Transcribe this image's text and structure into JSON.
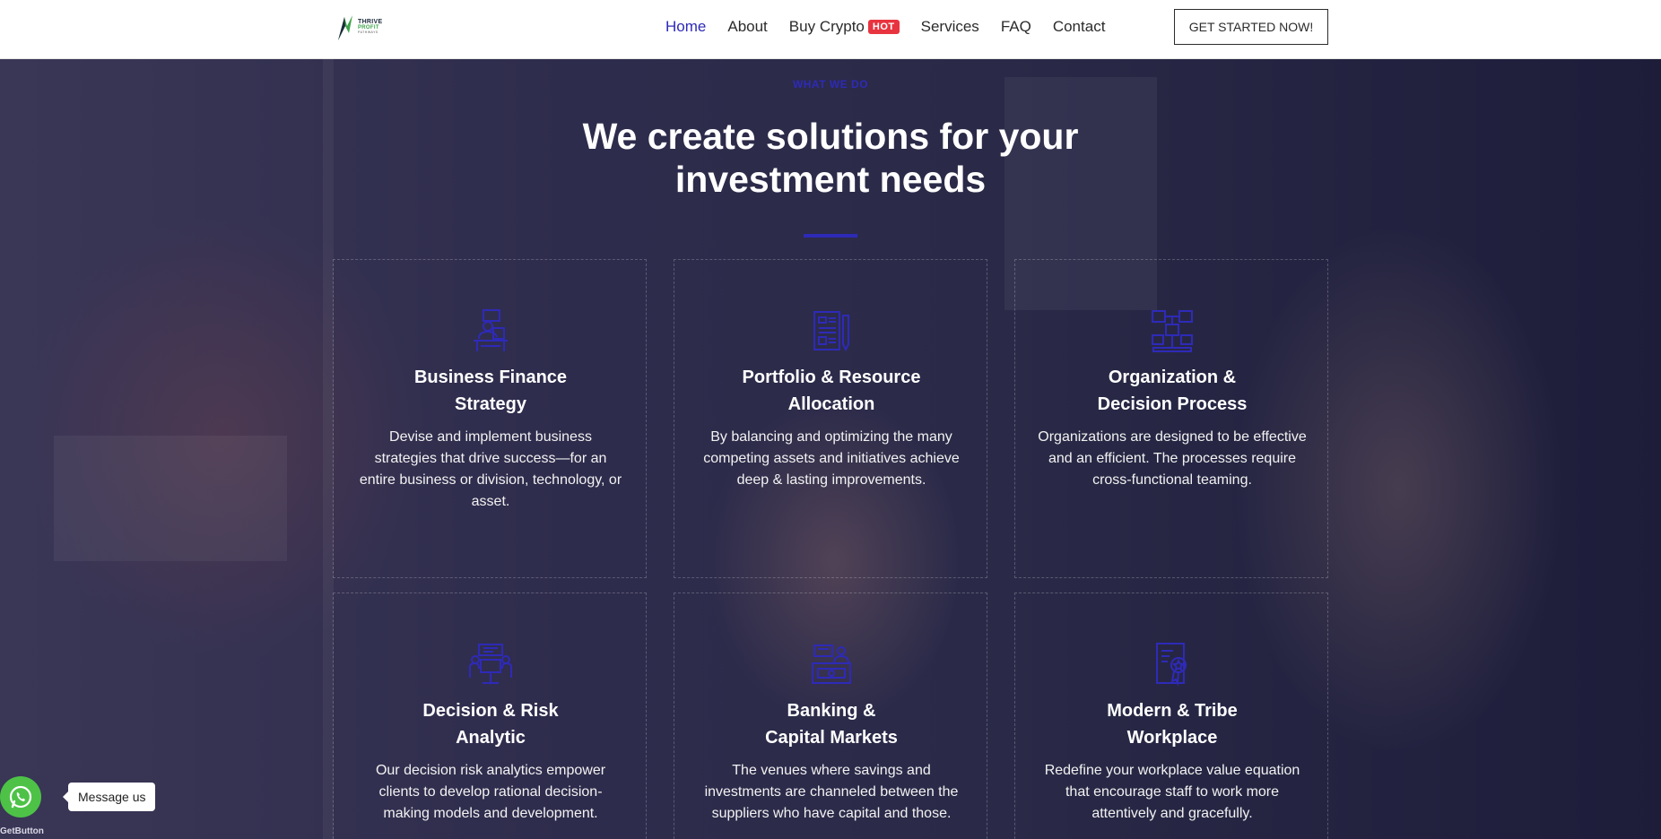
{
  "header": {
    "logo": {
      "line1": "THRIVE",
      "line2": "PROFIT",
      "line3": "PATHWAYS"
    },
    "nav": [
      {
        "label": "Home",
        "active": true
      },
      {
        "label": "About",
        "active": false
      },
      {
        "label": "Buy Crypto",
        "badge": "HOT",
        "active": false
      },
      {
        "label": "Services",
        "active": false
      },
      {
        "label": "FAQ",
        "active": false
      },
      {
        "label": "Contact",
        "active": false
      }
    ],
    "cta_label": "GET STARTED NOW!"
  },
  "section": {
    "eyebrow": "WHAT WE DO",
    "title_line1": "We create solutions for your",
    "title_line2": "investment needs"
  },
  "cards": [
    {
      "icon": "desk-worker-icon",
      "title_line1": "Business Finance",
      "title_line2": "Strategy",
      "desc_lines": [
        "Devise and implement business",
        "strategies that drive success—for an",
        "entire business or division, technology, or",
        "asset."
      ]
    },
    {
      "icon": "documents-icon",
      "title_line1": "Portfolio & Resource",
      "title_line2": "Allocation",
      "desc_lines": [
        "By balancing and optimizing the many",
        "competing assets and initiatives achieve",
        "deep & lasting improvements."
      ]
    },
    {
      "icon": "org-chart-icon",
      "title_line1": "Organization &",
      "title_line2": "Decision Process",
      "desc_lines": [
        "Organizations are designed to be effective",
        "and an efficient. The processes require",
        "cross-functional teaming."
      ]
    },
    {
      "icon": "meeting-icon",
      "title_line1": "Decision & Risk",
      "title_line2": "Analytic",
      "desc_lines": [
        "Our decision risk analytics empower",
        "clients to develop rational decision-",
        "making models and development."
      ]
    },
    {
      "icon": "cashier-icon",
      "title_line1": "Banking &",
      "title_line2": "Capital Markets",
      "desc_lines": [
        "The venues where savings and",
        "investments are channeled between the",
        "suppliers who have capital and those."
      ]
    },
    {
      "icon": "certificate-icon",
      "title_line1": "Modern & Tribe",
      "title_line2": "Workplace",
      "desc_lines": [
        "Redefine your workplace value equation",
        "that encourage staff to work more",
        "attentively and gracefully."
      ]
    }
  ],
  "widget": {
    "message_label": "Message us",
    "brand": "GetButton",
    "icon": "whatsapp-icon"
  },
  "colors": {
    "accent": "#2e2ab8",
    "badge": "#e8343f",
    "whatsapp": "#4dc247"
  }
}
